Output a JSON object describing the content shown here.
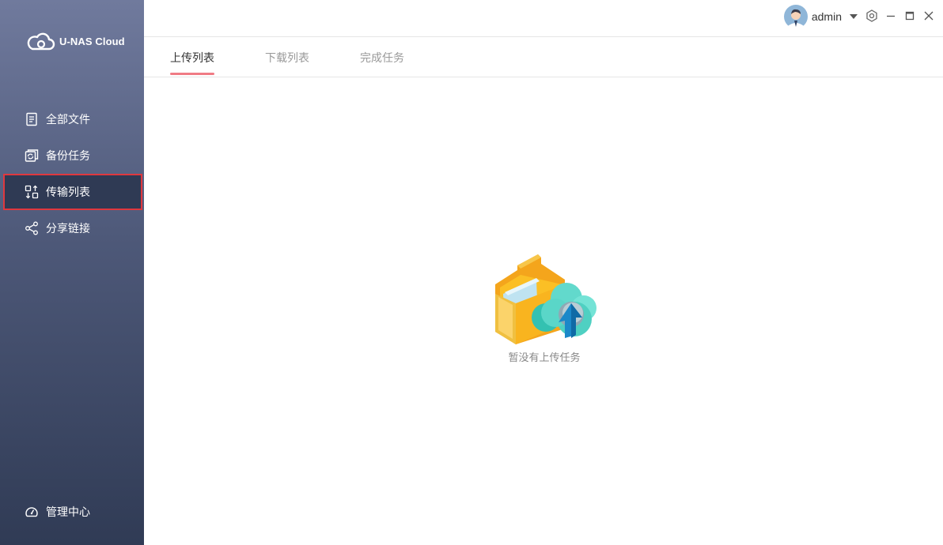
{
  "app": {
    "name": "U-NAS Cloud"
  },
  "sidebar": {
    "items": [
      {
        "label": "全部文件",
        "icon": "document-icon"
      },
      {
        "label": "备份任务",
        "icon": "backup-icon"
      },
      {
        "label": "传输列表",
        "icon": "transfer-icon",
        "active": true
      },
      {
        "label": "分享链接",
        "icon": "share-icon"
      }
    ],
    "bottom": {
      "label": "管理中心",
      "icon": "dashboard-icon"
    }
  },
  "header": {
    "username": "admin"
  },
  "tabs": [
    {
      "label": "上传列表",
      "active": true
    },
    {
      "label": "下载列表"
    },
    {
      "label": "完成任务"
    }
  ],
  "empty_state": {
    "message": "暂没有上传任务"
  },
  "colors": {
    "active_tab_underline": "#f07b85",
    "highlight_border": "#e0383e"
  }
}
